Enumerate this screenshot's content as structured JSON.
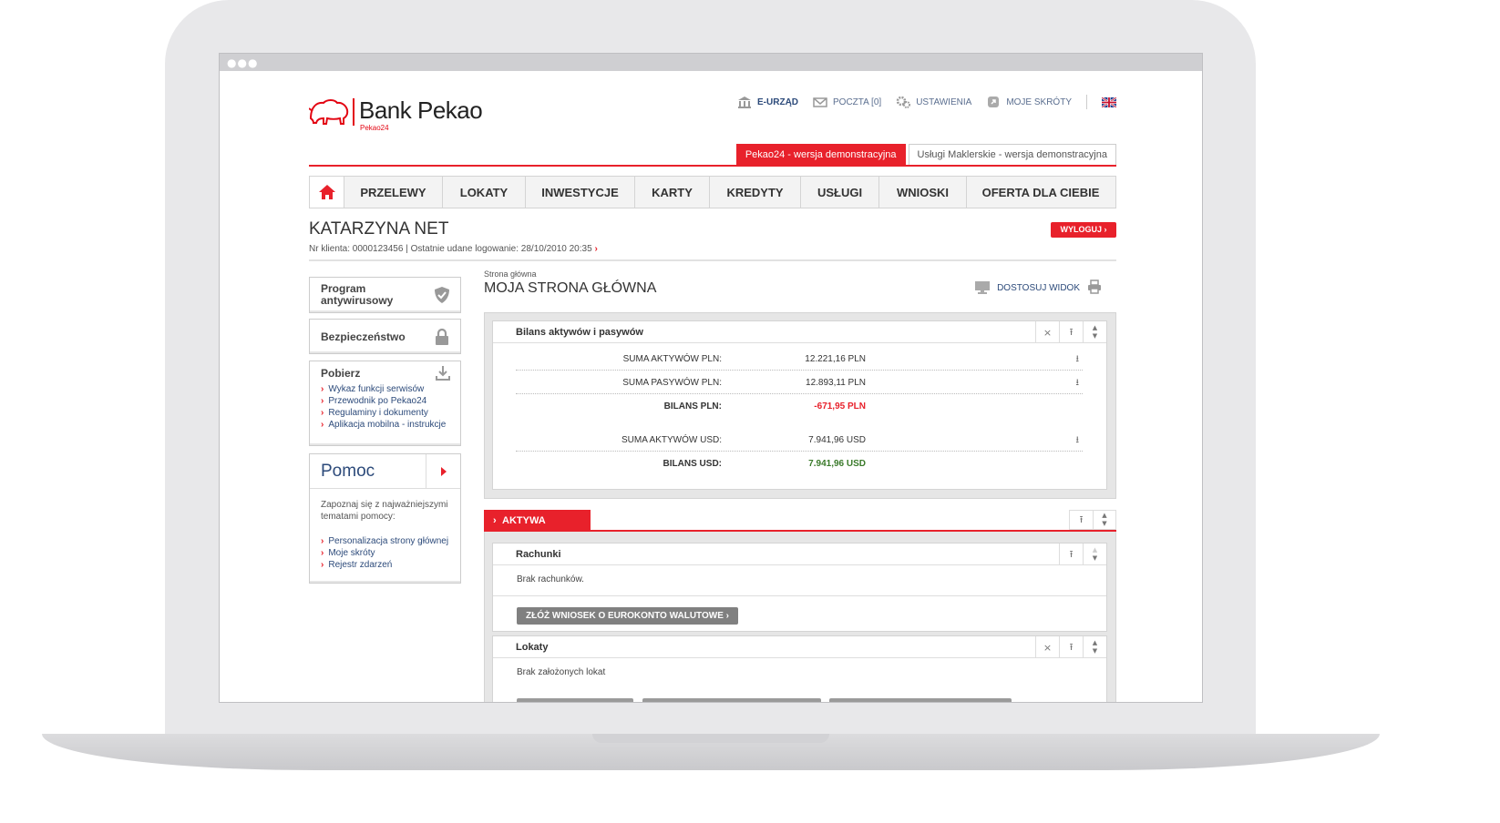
{
  "brand": {
    "name": "Bank Pekao",
    "sub": "Pekao24"
  },
  "top_links": [
    {
      "label": "E-URZĄD",
      "icon": "bank-building-icon",
      "active": true
    },
    {
      "label": "POCZTA [0]",
      "icon": "envelope-icon",
      "active": false
    },
    {
      "label": "USTAWIENIA",
      "icon": "gears-icon",
      "active": false
    },
    {
      "label": "MOJE SKRÓTY",
      "icon": "shortcut-icon",
      "active": false
    }
  ],
  "demo_tabs": {
    "pekao24": "Pekao24 - wersja demonstracyjna",
    "maklerskie": "Usługi Maklerskie - wersja demonstracyjna"
  },
  "nav": [
    "PRZELEWY",
    "LOKATY",
    "INWESTYCJE",
    "KARTY",
    "KREDYTY",
    "USŁUGI",
    "WNIOSKI",
    "OFERTA DLA CIEBIE"
  ],
  "user": {
    "name": "KATARZYNA NET",
    "client_label": "Nr klienta:",
    "client_no": "0000123456",
    "login_label": "Ostatnie udane logowanie:",
    "login_time": "28/10/2010 20:35",
    "logout": "WYLOGUJ ›"
  },
  "sidebar": {
    "antivirus": "Program antywirusowy",
    "security": "Bezpieczeństwo",
    "download": {
      "title": "Pobierz",
      "links": [
        "Wykaz funkcji serwisów",
        "Przewodnik po Pekao24",
        "Regulaminy i dokumenty",
        "Aplikacja mobilna - instrukcje"
      ]
    },
    "help": {
      "title": "Pomoc",
      "text": "Zapoznaj się z najważniejszymi tematami pomocy:",
      "links": [
        "Personalizacja strony głównej",
        "Moje skróty",
        "Rejestr zdarzeń"
      ]
    }
  },
  "main": {
    "breadcrumb": "Strona główna",
    "title": "MOJA STRONA GŁÓWNA",
    "customize": "DOSTOSUJ WIDOK"
  },
  "balance": {
    "title": "Bilans aktywów i pasywów",
    "rows": [
      {
        "label": "SUMA AKTYWÓW PLN:",
        "value": "12.221,16 PLN"
      },
      {
        "label": "SUMA PASYWÓW PLN:",
        "value": "12.893,11 PLN"
      },
      {
        "label": "BILANS PLN:",
        "value": "-671,95 PLN"
      },
      {
        "label": "SUMA AKTYWÓW USD:",
        "value": "7.941,96 USD"
      },
      {
        "label": "BILANS USD:",
        "value": "7.941,96 USD"
      }
    ]
  },
  "aktywa": {
    "tab": "AKTYWA",
    "accounts": {
      "title": "Rachunki",
      "empty": "Brak rachunków.",
      "button": "ZŁÓŻ WNIOSEK O EUROKONTO WALUTOWE ›"
    },
    "deposits": {
      "title": "Lokaty",
      "empty": "Brak założonych lokat"
    }
  },
  "colors": {
    "accent": "#e8212b",
    "link": "#2c4a7a",
    "negative": "#e8212b",
    "positive": "#3a7a2a"
  }
}
